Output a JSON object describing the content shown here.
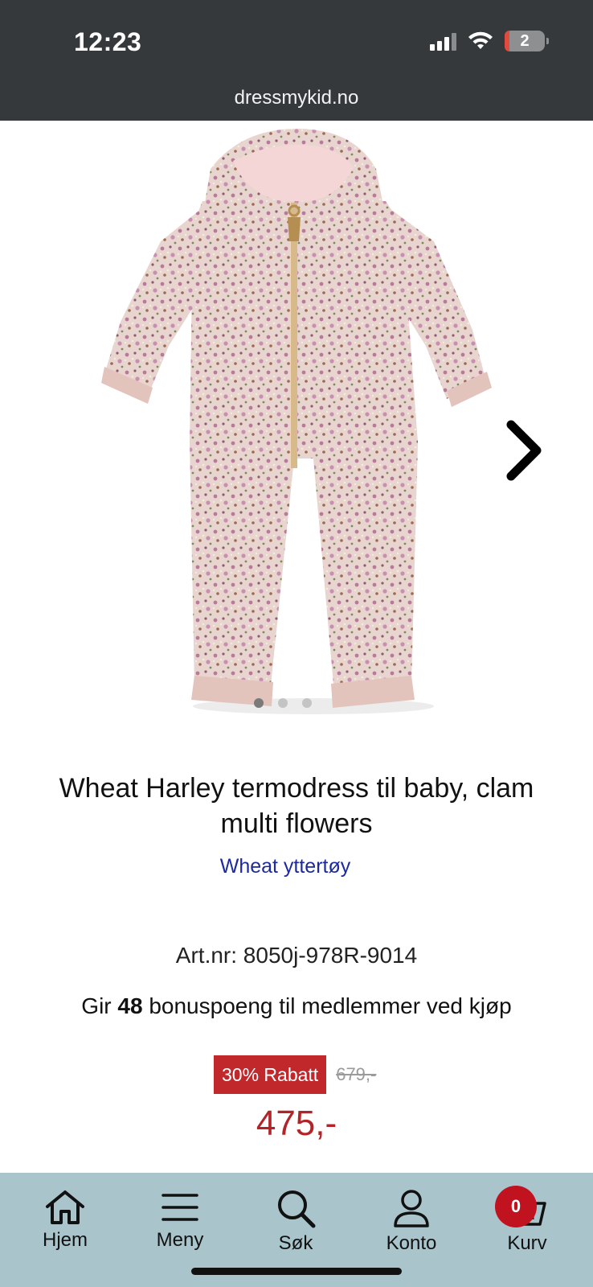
{
  "status_bar": {
    "time": "12:23",
    "battery": "2",
    "icons": [
      "signal-icon",
      "wifi-icon",
      "battery-icon"
    ]
  },
  "browser": {
    "url": "dressmykid.no"
  },
  "gallery": {
    "image": "floral-snowsuit-image",
    "slide_count": 3,
    "active_slide": 1,
    "next_icon": "chevron-right-icon"
  },
  "product": {
    "title": "Wheat Harley termodress til baby, clam multi flowers",
    "brand_link": "Wheat yttertøy",
    "art_nr": "Art.nr: 8050j-978R-9014",
    "bonus_prefix": "Gir ",
    "bonus_points": "48",
    "bonus_suffix": " bonuspoeng til medlemmer ved kjøp",
    "discount_label": "30% Rabatt",
    "old_price": "679,-",
    "price": "475,-"
  },
  "bottom_nav": {
    "items": [
      {
        "label": "Hjem",
        "icon": "home-icon"
      },
      {
        "label": "Meny",
        "icon": "menu-icon"
      },
      {
        "label": "Søk",
        "icon": "search-icon"
      },
      {
        "label": "Konto",
        "icon": "user-icon"
      },
      {
        "label": "Kurv",
        "icon": "basket-icon"
      }
    ],
    "cart_count": "0"
  },
  "colors": {
    "topbar": "#36393b",
    "brand_link": "#1d2a9f",
    "discount": "#c0282c",
    "price": "#b32428",
    "bottom_nav": "#a9c4cb",
    "badge": "#c1121f"
  }
}
